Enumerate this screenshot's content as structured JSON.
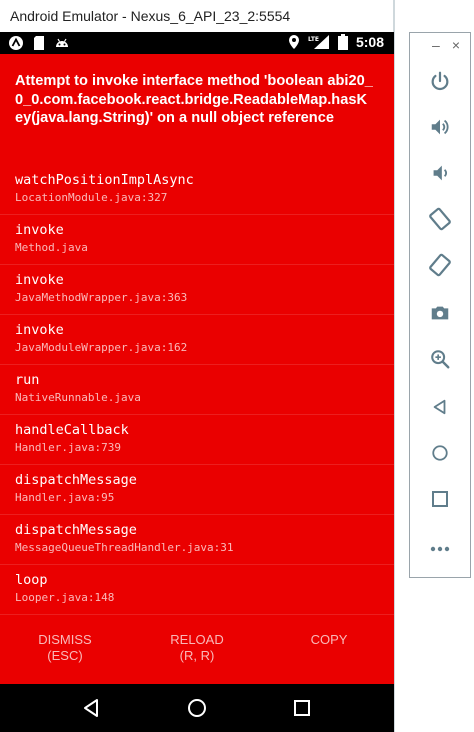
{
  "window": {
    "title": "Android Emulator - Nexus_6_API_23_2:5554"
  },
  "statusbar": {
    "time": "5:08",
    "network": "LTE"
  },
  "error": {
    "message": "Attempt to invoke interface method 'boolean abi20_0_0.com.facebook.react.bridge.ReadableMap.hasKey(java.lang.String)' on a null object reference",
    "frames": [
      {
        "method": "watchPositionImplAsync",
        "file": "LocationModule.java:327"
      },
      {
        "method": "invoke",
        "file": "Method.java"
      },
      {
        "method": "invoke",
        "file": "JavaMethodWrapper.java:363"
      },
      {
        "method": "invoke",
        "file": "JavaModuleWrapper.java:162"
      },
      {
        "method": "run",
        "file": "NativeRunnable.java"
      },
      {
        "method": "handleCallback",
        "file": "Handler.java:739"
      },
      {
        "method": "dispatchMessage",
        "file": "Handler.java:95"
      },
      {
        "method": "dispatchMessage",
        "file": "MessageQueueThreadHandler.java:31"
      },
      {
        "method": "loop",
        "file": "Looper.java:148"
      }
    ],
    "actions": {
      "dismiss": "DISMISS",
      "dismiss_hint": "(ESC)",
      "reload": "RELOAD",
      "reload_hint": "(R, R)",
      "copy": "COPY"
    }
  },
  "side_toolbar": {
    "window_controls": {
      "minimize": "–",
      "close": "×"
    },
    "tools": [
      "power-icon",
      "volume-up-icon",
      "volume-down-icon",
      "rotate-left-icon",
      "rotate-right-icon",
      "camera-icon",
      "zoom-icon",
      "back-icon",
      "home-icon",
      "overview-icon",
      "more-icon"
    ]
  },
  "colors": {
    "error_bg": "#ea0000",
    "toolbar_icon": "#607d8b"
  }
}
